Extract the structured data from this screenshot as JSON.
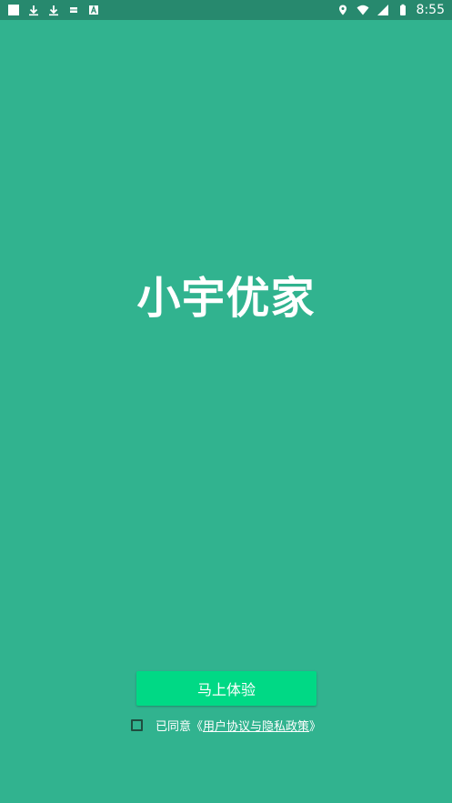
{
  "status_bar": {
    "time": "8:55",
    "left_icons": [
      "square-icon",
      "download-icon",
      "download-icon",
      "storage-icon",
      "a-badge-icon"
    ],
    "right_icons": [
      "location-icon",
      "wifi-icon",
      "signal-icon",
      "battery-icon"
    ]
  },
  "app": {
    "title": "小宇优家"
  },
  "cta": {
    "label": "马上体验"
  },
  "agreement": {
    "prefix": "已同意《",
    "link": "用户协议与隐私政策",
    "suffix": "》"
  },
  "colors": {
    "background": "#31b38f",
    "status_bar": "#27896e",
    "button": "#00d985",
    "checkbox_border": "#1f4d3f"
  }
}
